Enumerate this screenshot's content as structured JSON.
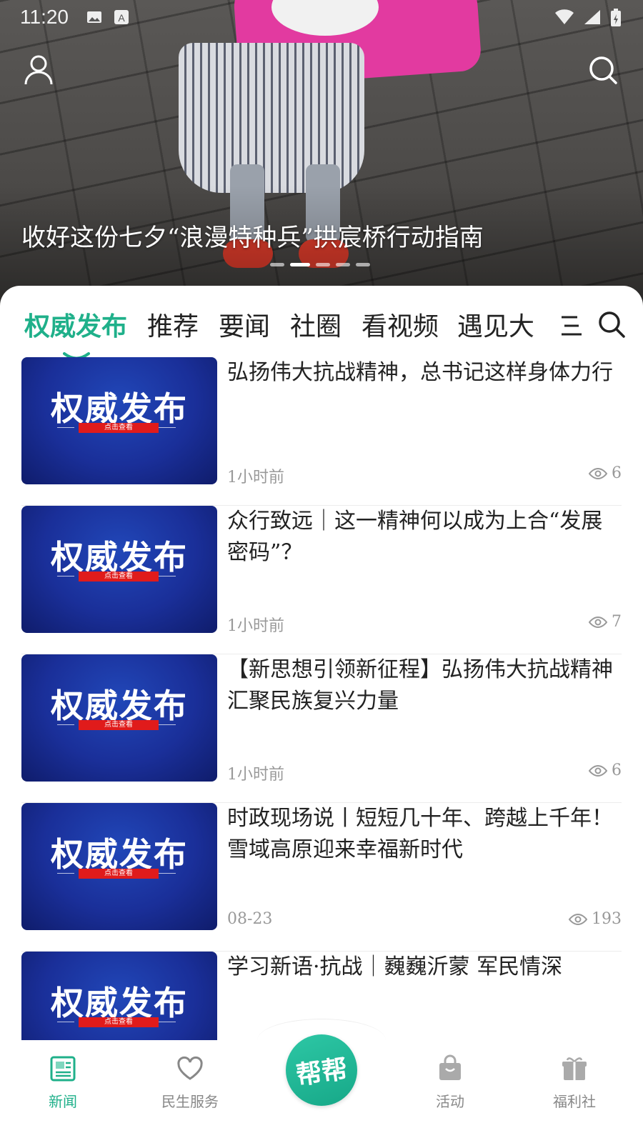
{
  "status_bar": {
    "time": "11:20"
  },
  "hero": {
    "title": "收好这份七夕“浪漫特种兵”拱宸桥行动指南",
    "slide_count": 5,
    "active_slide": 2
  },
  "tabs": [
    "权威发布",
    "推荐",
    "要闻",
    "社圈",
    "看视频",
    "遇见大"
  ],
  "active_tab": "权威发布",
  "colors": {
    "accent": "#1fb08a",
    "thumb_blue": "#1a2f99",
    "thumb_red": "#e01b1b"
  },
  "articles": [
    {
      "thumb_title": "权威发布",
      "thumb_band": "点击查看",
      "title": "弘扬伟大抗战精神，总书记这样身体力行",
      "time": "1小时前",
      "views": "6"
    },
    {
      "thumb_title": "权威发布",
      "thumb_band": "点击查看",
      "title": "众行致远｜这一精神何以成为上合“发展密码”？",
      "time": "1小时前",
      "views": "7"
    },
    {
      "thumb_title": "权威发布",
      "thumb_band": "点击查看",
      "title": "【新思想引领新征程】弘扬伟大抗战精神 汇聚民族复兴力量",
      "time": "1小时前",
      "views": "6"
    },
    {
      "thumb_title": "权威发布",
      "thumb_band": "点击查看",
      "title": "时政现场说丨短短几十年、跨越上千年！雪域高原迎来幸福新时代",
      "time": "08-23",
      "views": "193"
    },
    {
      "thumb_title": "权威发布",
      "thumb_band": "点击查看",
      "title": "学习新语·抗战｜巍巍沂蒙 军民情深",
      "time": "",
      "views": ""
    }
  ],
  "bottom_nav": {
    "news": "新闻",
    "services": "民生服务",
    "center": "帮帮",
    "activity": "活动",
    "welfare": "福利社"
  }
}
